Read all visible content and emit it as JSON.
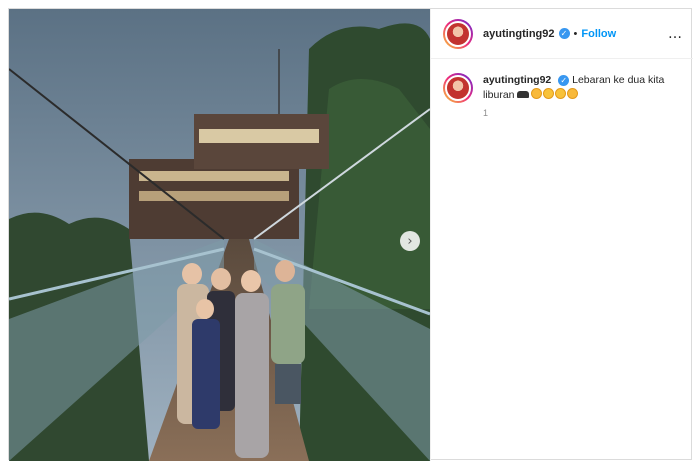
{
  "post": {
    "author": {
      "username": "ayutingting92",
      "verified": true,
      "avatar_icon": "profile-avatar",
      "follow_label": "Follow",
      "separator": "•"
    },
    "more_label": "…",
    "carousel_next_label": "›",
    "caption": {
      "username": "ayutingting92",
      "text": "Lebaran ke dua kita liburan",
      "emoji_icons": [
        "car-icon",
        "heart-eyes-face-icon",
        "smiling-face-icon",
        "smiling-face-icon",
        "heart-eyes-face-icon"
      ],
      "meta": "1"
    },
    "colors": {
      "link": "#0095f6",
      "verified": "#3897f0",
      "text": "#262626",
      "border": "#dbdbdb"
    }
  }
}
